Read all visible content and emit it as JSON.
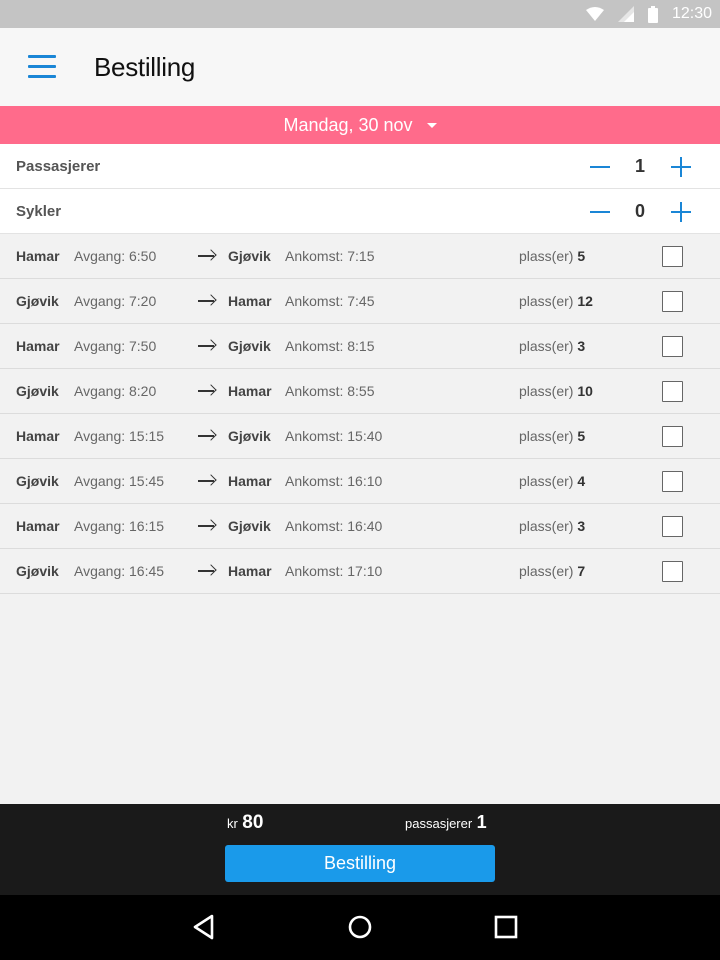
{
  "status_bar": {
    "time": "12:30",
    "icons": [
      "wifi-icon",
      "signal-icon",
      "battery-icon"
    ]
  },
  "app_bar": {
    "title": "Bestilling",
    "menu_icon": "menu-icon"
  },
  "date_selector": {
    "label": "Mandag, 30 nov",
    "icon": "dropdown-caret-icon"
  },
  "counters": [
    {
      "label": "Passasjerer",
      "value": "1"
    },
    {
      "label": "Sykler",
      "value": "0"
    }
  ],
  "trips": [
    {
      "from": "Hamar",
      "departure": "Avgang: 6:50",
      "to": "Gjøvik",
      "arrival": "Ankomst: 7:15",
      "seats_label": "plass(er)",
      "seats": "5"
    },
    {
      "from": "Gjøvik",
      "departure": "Avgang: 7:20",
      "to": "Hamar",
      "arrival": "Ankomst: 7:45",
      "seats_label": "plass(er)",
      "seats": "12"
    },
    {
      "from": "Hamar",
      "departure": "Avgang: 7:50",
      "to": "Gjøvik",
      "arrival": "Ankomst: 8:15",
      "seats_label": "plass(er)",
      "seats": "3"
    },
    {
      "from": "Gjøvik",
      "departure": "Avgang: 8:20",
      "to": "Hamar",
      "arrival": "Ankomst: 8:55",
      "seats_label": "plass(er)",
      "seats": "10"
    },
    {
      "from": "Hamar",
      "departure": "Avgang: 15:15",
      "to": "Gjøvik",
      "arrival": "Ankomst: 15:40",
      "seats_label": "plass(er)",
      "seats": "5"
    },
    {
      "from": "Gjøvik",
      "departure": "Avgang: 15:45",
      "to": "Hamar",
      "arrival": "Ankomst: 16:10",
      "seats_label": "plass(er)",
      "seats": "4"
    },
    {
      "from": "Hamar",
      "departure": "Avgang: 16:15",
      "to": "Gjøvik",
      "arrival": "Ankomst: 16:40",
      "seats_label": "plass(er)",
      "seats": "3"
    },
    {
      "from": "Gjøvik",
      "departure": "Avgang: 16:45",
      "to": "Hamar",
      "arrival": "Ankomst: 17:10",
      "seats_label": "plass(er)",
      "seats": "7"
    }
  ],
  "summary": {
    "price_label": "kr",
    "price": "80",
    "passengers_label": "passasjerer",
    "passengers": "1",
    "button_label": "Bestilling"
  },
  "nav_bar": {
    "icons": [
      "back-icon",
      "home-icon",
      "recents-icon"
    ]
  },
  "colors": {
    "accent": "#1a86d6",
    "date_bar": "#ff6b8b",
    "button": "#1a9aea",
    "summary_bg": "#1a1a1a"
  }
}
